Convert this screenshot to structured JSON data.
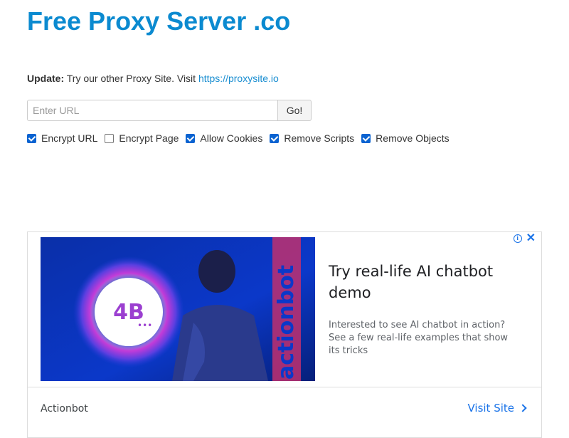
{
  "site": {
    "title": "Free Proxy Server .co"
  },
  "update": {
    "label": "Update:",
    "text": "Try our other Proxy Site. Visit",
    "link_text": "https://proxysite.io"
  },
  "url_form": {
    "placeholder": "Enter URL",
    "value": "",
    "go_label": "Go!"
  },
  "options": [
    {
      "label": "Encrypt URL",
      "checked": true
    },
    {
      "label": "Encrypt Page",
      "checked": false
    },
    {
      "label": "Allow Cookies",
      "checked": true
    },
    {
      "label": "Remove Scripts",
      "checked": true
    },
    {
      "label": "Remove Objects",
      "checked": true
    }
  ],
  "ad": {
    "image_brand_text": "actionbot",
    "logo_text": "4B",
    "headline": "Try real-life AI chatbot demo",
    "description": "Interested to see AI chatbot in action? See a few real-life examples that show its tricks",
    "advertiser": "Actionbot",
    "cta": "Visit Site",
    "info_icon": "info-icon",
    "close_icon": "close-icon"
  },
  "colors": {
    "title": "#0b8ad0",
    "link": "#1a8ed1",
    "checkbox_checked": "#0a63d1",
    "ad_blue": "#1a73e8"
  }
}
